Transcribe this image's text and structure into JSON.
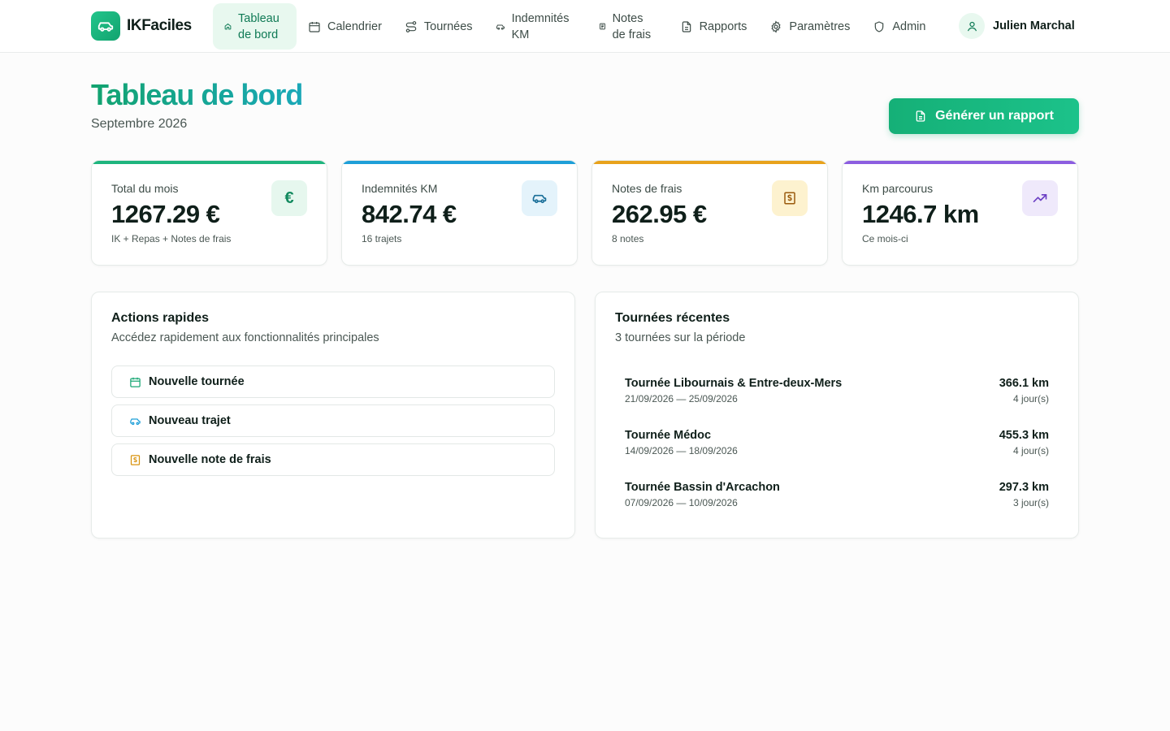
{
  "app": {
    "name": "IKFaciles"
  },
  "nav": {
    "items": [
      {
        "label": "Tableau de bord",
        "icon": "home-icon"
      },
      {
        "label": "Calendrier",
        "icon": "calendar-icon"
      },
      {
        "label": "Tournées",
        "icon": "route-icon"
      },
      {
        "label": "Indemnités KM",
        "icon": "car-icon"
      },
      {
        "label": "Notes de frais",
        "icon": "receipt-icon"
      },
      {
        "label": "Rapports",
        "icon": "file-text-icon"
      },
      {
        "label": "Paramètres",
        "icon": "gear-icon"
      },
      {
        "label": "Admin",
        "icon": "shield-icon"
      }
    ],
    "active": "Tableau de bord"
  },
  "user": {
    "name": "Julien Marchal",
    "icon": "user-icon"
  },
  "header": {
    "title": "Tableau de bord",
    "subtitle": "Septembre 2026",
    "generate_label": "Générer un rapport"
  },
  "stats": [
    {
      "label": "Total du mois",
      "value": "1267.29 €",
      "sub": "IK + Repas + Notes de frais",
      "icon": "euro-icon",
      "accent": "#1fb57e"
    },
    {
      "label": "Indemnités KM",
      "value": "842.74 €",
      "sub": "16 trajets",
      "icon": "car-icon",
      "accent": "#1e9fd8"
    },
    {
      "label": "Notes de frais",
      "value": "262.95 €",
      "sub": "8 notes",
      "icon": "receipt-icon",
      "accent": "#e8a21c"
    },
    {
      "label": "Km parcourus",
      "value": "1246.7 km",
      "sub": "Ce mois-ci",
      "icon": "trending-up-icon",
      "accent": "#8c5ee0"
    }
  ],
  "quick_actions": {
    "title": "Actions rapides",
    "subtitle": "Accédez rapidement aux fonctionnalités principales",
    "items": [
      {
        "label": "Nouvelle tournée",
        "icon": "calendar-icon"
      },
      {
        "label": "Nouveau trajet",
        "icon": "car-icon"
      },
      {
        "label": "Nouvelle note de frais",
        "icon": "receipt-icon"
      }
    ]
  },
  "recent_tours": {
    "title": "Tournées récentes",
    "subtitle": "3 tournées sur la période",
    "items": [
      {
        "name": "Tournée Libournais & Entre-deux-Mers",
        "dates": "21/09/2026 — 25/09/2026",
        "km": "366.1 km",
        "days": "4 jour(s)"
      },
      {
        "name": "Tournée Médoc",
        "dates": "14/09/2026 — 18/09/2026",
        "km": "455.3 km",
        "days": "4 jour(s)"
      },
      {
        "name": "Tournée Bassin d'Arcachon",
        "dates": "07/09/2026 — 10/09/2026",
        "km": "297.3 km",
        "days": "3 jour(s)"
      }
    ]
  },
  "colors": {
    "brand": "#15b077",
    "text": "#0f1f1a",
    "muted": "#4a5753"
  }
}
